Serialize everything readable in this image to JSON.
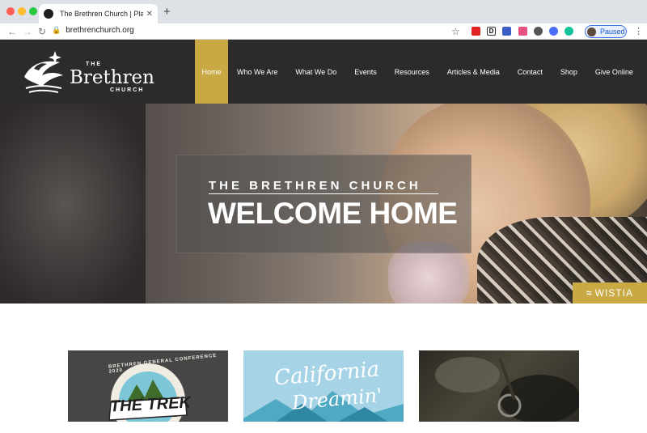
{
  "browser": {
    "tab_title": "The Brethren Church | Planting C",
    "url": "brethrenchurch.org",
    "profile_status": "Paused"
  },
  "site": {
    "logo": {
      "the": "THE",
      "name": "Brethren",
      "sub": "CHURCH"
    },
    "nav": [
      {
        "label": "Home"
      },
      {
        "label": "Who We Are"
      },
      {
        "label": "What We Do"
      },
      {
        "label": "Events"
      },
      {
        "label": "Resources"
      },
      {
        "label": "Articles & Media"
      },
      {
        "label": "Contact"
      },
      {
        "label": "Shop"
      },
      {
        "label": "Give Online"
      }
    ],
    "accent_color": "#c9a944",
    "header_color": "#2b2b2b"
  },
  "hero": {
    "kicker": "THE BRETHREN CHURCH",
    "headline": "WELCOME HOME",
    "video_badge": "WISTIA"
  },
  "cards": [
    {
      "arc_text": "BRETHREN GENERAL CONFERENCE 2020",
      "title": "THE TREK"
    },
    {
      "title_line1": "California",
      "title_line2": "Dreamin'"
    },
    {}
  ]
}
